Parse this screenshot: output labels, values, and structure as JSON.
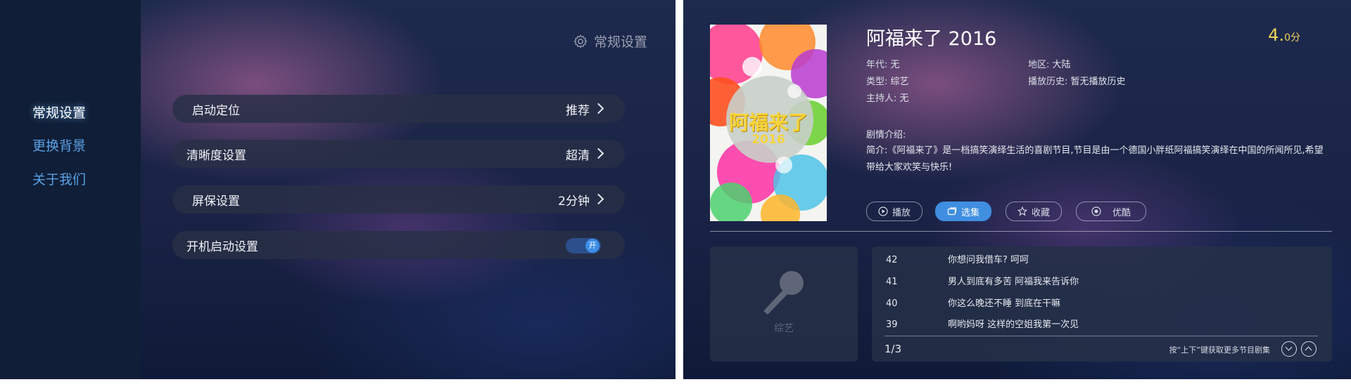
{
  "settings": {
    "page_title": "常规设置",
    "sidebar": {
      "items": [
        {
          "label": "常规设置",
          "active": true
        },
        {
          "label": "更换背景",
          "active": false
        },
        {
          "label": "关于我们",
          "active": false
        }
      ]
    },
    "rows": [
      {
        "label": "启动定位",
        "value": "推荐"
      },
      {
        "label": "清晰度设置",
        "value": "超清"
      },
      {
        "label": "屏保设置",
        "value": "2分钟"
      },
      {
        "label": "开机启动设置",
        "toggle_text": "开",
        "toggle_on": true
      }
    ]
  },
  "detail": {
    "poster": {
      "title": "阿福来了",
      "year": "2016"
    },
    "title": "阿福来了 2016",
    "rating": {
      "value": "4.",
      "suffix": "0分"
    },
    "meta": {
      "year_label": "年代:",
      "year_value": "无",
      "region_label": "地区:",
      "region_value": "大陆",
      "type_label": "类型:",
      "type_value": "综艺",
      "history_label": "播放历史:",
      "history_value": "暂无播放历史",
      "host_label": "主持人:",
      "host_value": "无"
    },
    "synopsis_label": "剧情介绍:",
    "synopsis": "简介:《阿福来了》是一档搞笑演绎生活的喜剧节目,节目是由一个德国小胖纸阿福搞笑演绎在中国的所闻所见,希望带给大家欢笑与快乐!",
    "buttons": [
      {
        "label": "播放",
        "icon": "play-circle-icon",
        "active": false
      },
      {
        "label": "选集",
        "icon": "episodes-icon",
        "active": true
      },
      {
        "label": "收藏",
        "icon": "star-icon",
        "active": false
      },
      {
        "label": "优酷",
        "icon": "source-icon",
        "active": false
      }
    ],
    "category": "综艺",
    "episodes": [
      {
        "num": "42",
        "title": "你想问我借车? 呵呵"
      },
      {
        "num": "41",
        "title": "男人到底有多苦 阿福我来告诉你"
      },
      {
        "num": "40",
        "title": "你这么晚还不睡 到底在干嘛"
      },
      {
        "num": "39",
        "title": "啊哟妈呀 这样的空姐我第一次见"
      }
    ],
    "page": "1/3",
    "hint": "按“上下”键获取更多节目剧集"
  }
}
